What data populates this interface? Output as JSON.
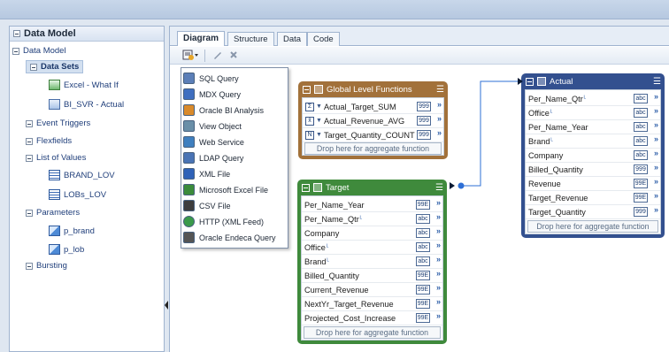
{
  "left_panel": {
    "title": "Data Model",
    "tree": {
      "root": "Data Model",
      "data_sets": "Data Sets",
      "data_set_items": [
        "Excel - What If",
        "BI_SVR - Actual"
      ],
      "event_triggers": "Event Triggers",
      "flexfields": "Flexfields",
      "list_of_values": "List of Values",
      "lov_items": [
        "BRAND_LOV",
        "LOBs_LOV"
      ],
      "parameters": "Parameters",
      "parameter_items": [
        "p_brand",
        "p_lob"
      ],
      "bursting": "Bursting"
    }
  },
  "tabs": [
    "Diagram",
    "Structure",
    "Data",
    "Code"
  ],
  "active_tab": "Diagram",
  "new_dataset_menu": {
    "items": [
      {
        "label": "SQL Query",
        "icon": "sql-query-icon",
        "color": "#5c7fb8"
      },
      {
        "label": "MDX Query",
        "icon": "mdx-query-icon",
        "color": "#3f6fc0"
      },
      {
        "label": "Oracle BI Analysis",
        "icon": "oracle-bi-analysis-icon",
        "color": "#d98a2b"
      },
      {
        "label": "View Object",
        "icon": "view-object-icon",
        "color": "#6a8fa8"
      },
      {
        "label": "Web Service",
        "icon": "web-service-icon",
        "color": "#3f7fbf"
      },
      {
        "label": "LDAP Query",
        "icon": "ldap-query-icon",
        "color": "#4a74b5"
      },
      {
        "label": "XML File",
        "icon": "xml-file-icon",
        "color": "#2f62b8"
      },
      {
        "label": "Microsoft Excel File",
        "icon": "excel-file-icon",
        "color": "#3b8b3b"
      },
      {
        "label": "CSV File",
        "icon": "csv-file-icon",
        "color": "#3d3d3d"
      },
      {
        "label": "HTTP (XML Feed)",
        "icon": "http-xml-feed-icon",
        "color": "#3a9a4a"
      },
      {
        "label": "Oracle Endeca Query",
        "icon": "oracle-endeca-query-icon",
        "color": "#555555"
      }
    ]
  },
  "global_functions": {
    "title": "Global Level Functions",
    "header_color": "#a2713a",
    "rows": [
      {
        "fx": "Σ",
        "label": "Actual_Target_SUM",
        "type": "999"
      },
      {
        "fx": "x̄",
        "label": "Actual_Revenue_AVG",
        "type": "999"
      },
      {
        "fx": "N",
        "label": "Target_Quantity_COUNT",
        "type": "999"
      }
    ],
    "drop_text": "Drop here for aggregate function"
  },
  "target": {
    "title": "Target",
    "header_color": "#3f8a3c",
    "rows": [
      {
        "label": "Per_Name_Year",
        "type": "99E"
      },
      {
        "label": "Per_Name_Qtr",
        "type": "abc",
        "key": true
      },
      {
        "label": "Company",
        "type": "abc"
      },
      {
        "label": "Office",
        "type": "abc",
        "key": true
      },
      {
        "label": "Brand",
        "type": "abc",
        "key": true
      },
      {
        "label": "Billed_Quantity",
        "type": "99E"
      },
      {
        "label": "Current_Revenue",
        "type": "99E"
      },
      {
        "label": "NextYr_Target_Revenue",
        "type": "99E"
      },
      {
        "label": "Projected_Cost_Increase",
        "type": "99E"
      }
    ],
    "drop_text": "Drop here for aggregate function"
  },
  "actual": {
    "title": "Actual",
    "header_color": "#33508f",
    "rows": [
      {
        "label": "Per_Name_Qtr",
        "type": "abc",
        "key": true
      },
      {
        "label": "Office",
        "type": "abc",
        "key": true
      },
      {
        "label": "Per_Name_Year",
        "type": "abc"
      },
      {
        "label": "Brand",
        "type": "abc",
        "key": true
      },
      {
        "label": "Company",
        "type": "abc"
      },
      {
        "label": "Billed_Quantity",
        "type": "999"
      },
      {
        "label": "Revenue",
        "type": "99E"
      },
      {
        "label": "Target_Revenue",
        "type": "99E"
      },
      {
        "label": "Target_Quantity",
        "type": "999"
      }
    ],
    "drop_text": "Drop here for aggregate function"
  },
  "link_color": "#2d6fd6"
}
